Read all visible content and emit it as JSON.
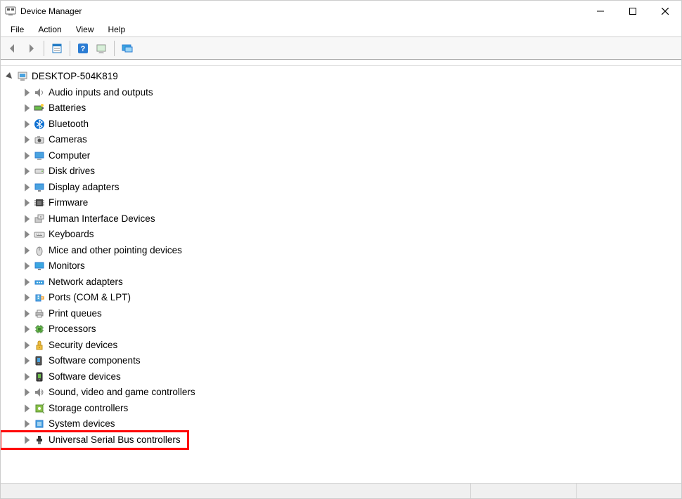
{
  "window": {
    "title": "Device Manager"
  },
  "menu": {
    "items": [
      "File",
      "Action",
      "View",
      "Help"
    ]
  },
  "toolbar": {
    "back": "Back",
    "forward": "Forward",
    "properties": "Properties",
    "help": "Help",
    "scan": "Scan for hardware changes",
    "monitor": "Show hidden devices"
  },
  "tree": {
    "root": {
      "label": "DESKTOP-504K819",
      "expanded": true
    },
    "categories": [
      {
        "icon": "speaker",
        "label": "Audio inputs and outputs"
      },
      {
        "icon": "battery",
        "label": "Batteries"
      },
      {
        "icon": "bluetooth",
        "label": "Bluetooth"
      },
      {
        "icon": "camera",
        "label": "Cameras"
      },
      {
        "icon": "computer",
        "label": "Computer"
      },
      {
        "icon": "disk",
        "label": "Disk drives"
      },
      {
        "icon": "display",
        "label": "Display adapters"
      },
      {
        "icon": "firmware",
        "label": "Firmware"
      },
      {
        "icon": "hid",
        "label": "Human Interface Devices"
      },
      {
        "icon": "keyboard",
        "label": "Keyboards"
      },
      {
        "icon": "mouse",
        "label": "Mice and other pointing devices"
      },
      {
        "icon": "monitor",
        "label": "Monitors"
      },
      {
        "icon": "network",
        "label": "Network adapters"
      },
      {
        "icon": "ports",
        "label": "Ports (COM & LPT)"
      },
      {
        "icon": "printer",
        "label": "Print queues"
      },
      {
        "icon": "cpu",
        "label": "Processors"
      },
      {
        "icon": "security",
        "label": "Security devices"
      },
      {
        "icon": "softcomp",
        "label": "Software components"
      },
      {
        "icon": "softdev",
        "label": "Software devices"
      },
      {
        "icon": "sound",
        "label": "Sound, video and game controllers"
      },
      {
        "icon": "storage",
        "label": "Storage controllers"
      },
      {
        "icon": "system",
        "label": "System devices"
      },
      {
        "icon": "usb",
        "label": "Universal Serial Bus controllers"
      }
    ]
  },
  "highlight": {
    "target_index": 22
  }
}
